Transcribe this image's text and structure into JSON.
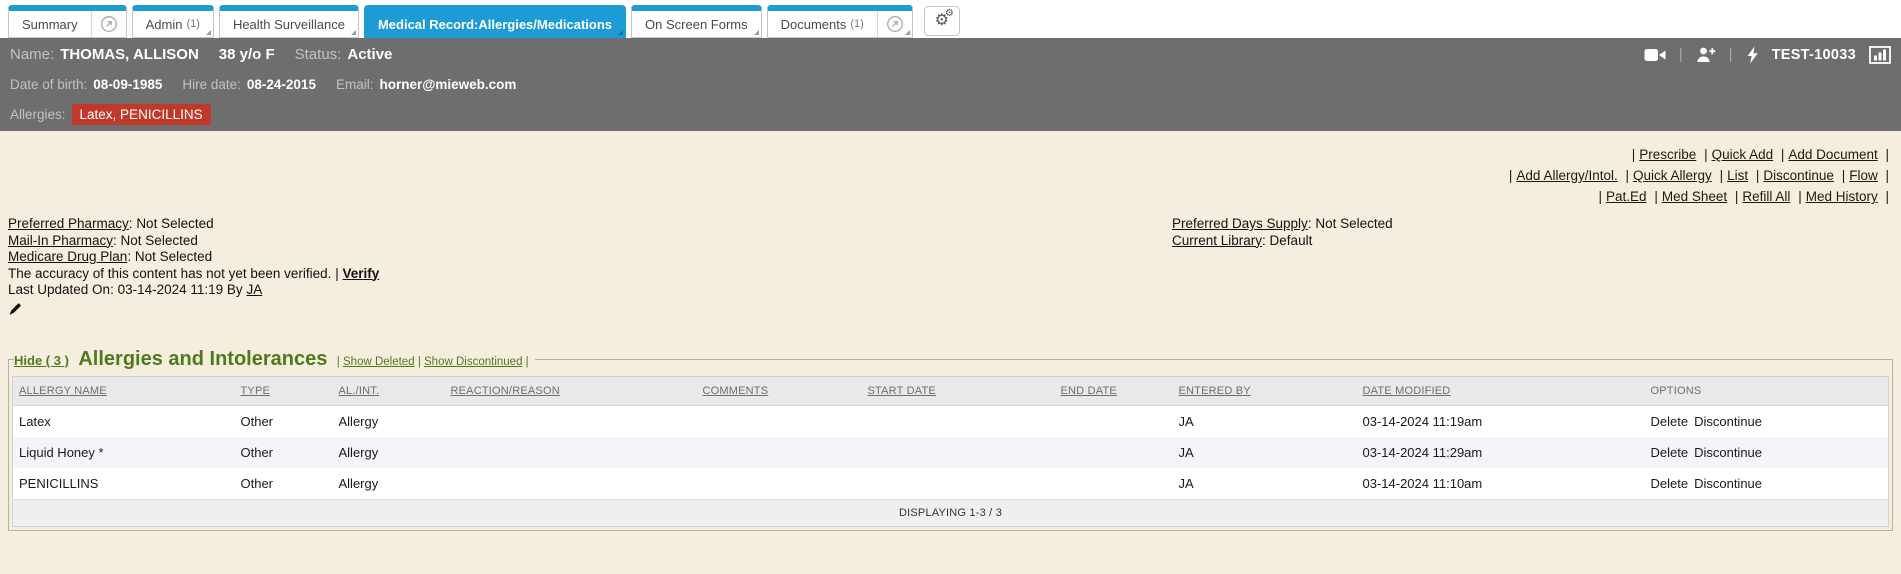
{
  "separator": "|",
  "tabs": {
    "summary": {
      "label": "Summary"
    },
    "admin": {
      "label": "Admin",
      "count": "(1)"
    },
    "health": {
      "label": "Health Surveillance"
    },
    "medical": {
      "label": "Medical Record:Allergies/Medications"
    },
    "forms": {
      "label": "On Screen Forms"
    },
    "documents": {
      "label": "Documents",
      "count": "(1)"
    }
  },
  "patient": {
    "name_label": "Name:",
    "name": "THOMAS, ALLISON",
    "age_sex": "38 y/o F",
    "status_label": "Status:",
    "status": "Active",
    "id": "TEST-10033",
    "dob_label": "Date of birth:",
    "dob": "08-09-1985",
    "hire_label": "Hire date:",
    "hire": "08-24-2015",
    "email_label": "Email:",
    "email": "horner@mieweb.com",
    "allergies_label": "Allergies:",
    "allergies_badge": "Latex, PENICILLINS"
  },
  "quicklinks": {
    "row1": [
      "Prescribe",
      "Quick Add",
      "Add Document"
    ],
    "row2": [
      "Add Allergy/Intol.",
      "Quick Allergy",
      "List",
      "Discontinue",
      "Flow"
    ],
    "row3": [
      "Pat.Ed",
      "Med Sheet",
      "Refill All",
      "Med History"
    ]
  },
  "info": {
    "left": [
      {
        "label": "Preferred Pharmacy",
        "value": "Not Selected"
      },
      {
        "label": "Mail-In Pharmacy",
        "value": "Not Selected"
      },
      {
        "label": "Medicare Drug Plan",
        "value": "Not Selected"
      }
    ],
    "verify_text": "The accuracy of this content has not yet been verified.",
    "verify_link": "Verify",
    "last_updated_text": "Last Updated On: 03-14-2024 11:19 By",
    "last_updated_by": "JA",
    "right": [
      {
        "label": "Preferred Days Supply",
        "value": "Not Selected"
      },
      {
        "label": "Current Library",
        "value": "Default"
      }
    ]
  },
  "allergy_section": {
    "hide_link": "Hide ( 3 )",
    "title": "Allergies and Intolerances",
    "show_deleted": "Show Deleted",
    "show_discontinued": "Show Discontinued",
    "columns": [
      "ALLERGY NAME",
      "TYPE",
      "AL./INT.",
      "REACTION/REASON",
      "COMMENTS",
      "START DATE",
      "END DATE",
      "ENTERED BY",
      "DATE MODIFIED",
      "OPTIONS"
    ],
    "rows": [
      {
        "name": "Latex",
        "type": "Other",
        "al_int": "Allergy",
        "reaction": "",
        "comments": "",
        "start": "",
        "end": "",
        "entered_by": "JA",
        "modified": "03-14-2024 11:19am",
        "opt1": "Delete",
        "opt2": "Discontinue"
      },
      {
        "name": "Liquid Honey *",
        "type": "Other",
        "al_int": "Allergy",
        "reaction": "",
        "comments": "",
        "start": "",
        "end": "",
        "entered_by": "JA",
        "modified": "03-14-2024 11:29am",
        "opt1": "Delete",
        "opt2": "Discontinue"
      },
      {
        "name": "PENICILLINS",
        "type": "Other",
        "al_int": "Allergy",
        "reaction": "",
        "comments": "",
        "start": "",
        "end": "",
        "entered_by": "JA",
        "modified": "03-14-2024 11:10am",
        "opt1": "Delete",
        "opt2": "Discontinue"
      }
    ],
    "footer": "DISPLAYING 1-3 / 3"
  },
  "colors": {
    "accent_blue": "#1d9bd5",
    "header_gray": "#6e6e6e",
    "badge_red": "#c0392b",
    "content_beige": "#f5eede",
    "section_green": "#4e7a1c"
  }
}
